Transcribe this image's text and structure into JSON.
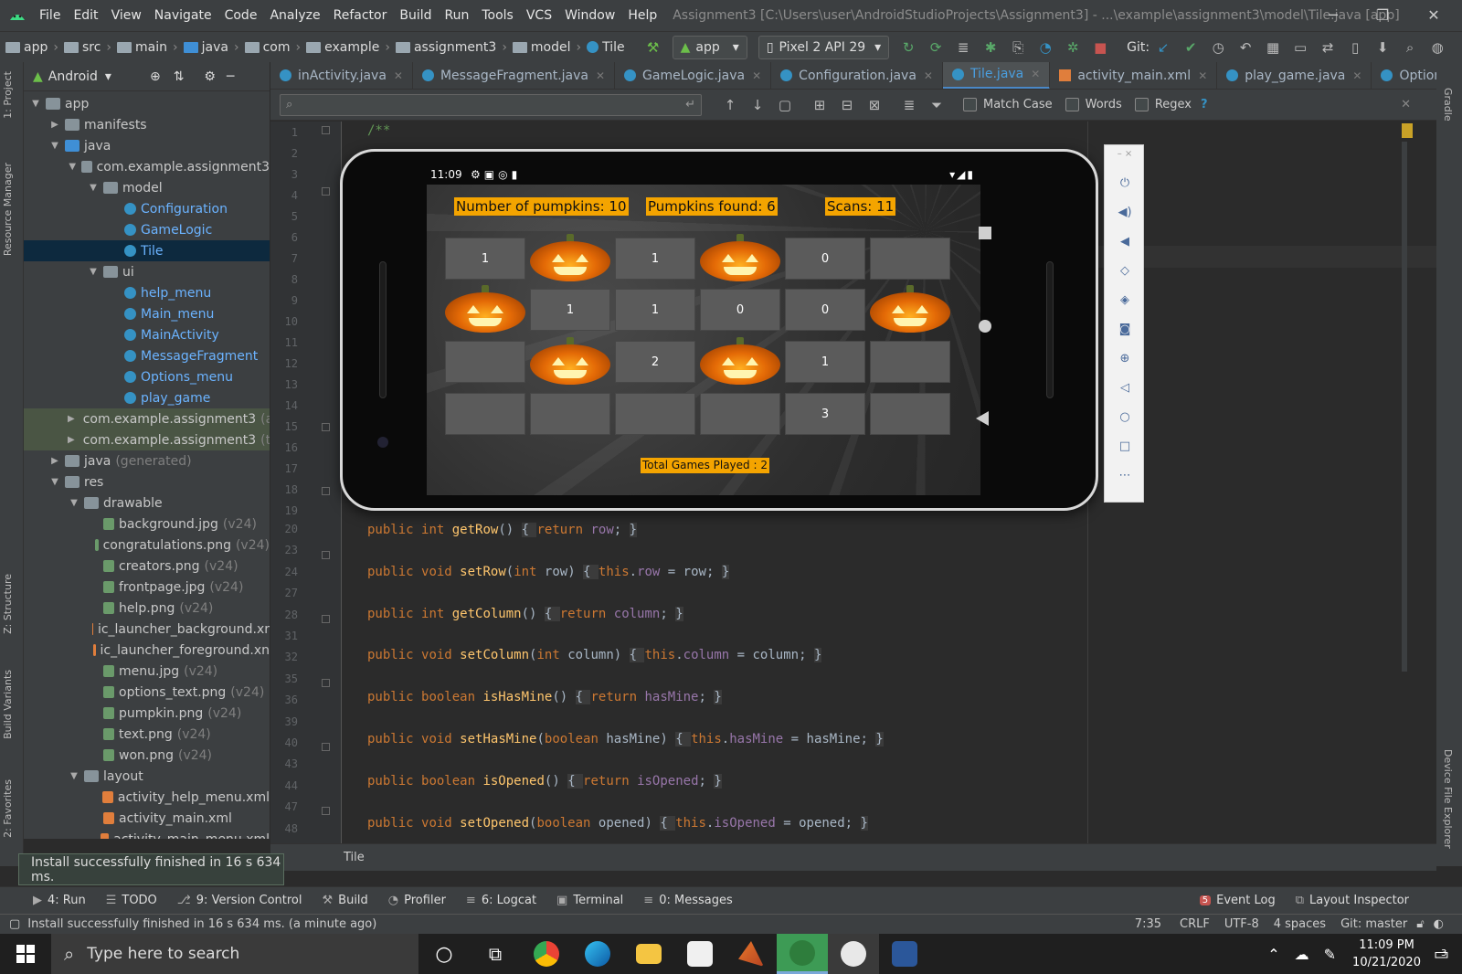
{
  "titlebar": {
    "menus": [
      "File",
      "Edit",
      "View",
      "Navigate",
      "Code",
      "Analyze",
      "Refactor",
      "Build",
      "Run",
      "Tools",
      "VCS",
      "Window",
      "Help"
    ],
    "title": "Assignment3 [C:\\Users\\user\\AndroidStudioProjects\\Assignment3] - ...\\example\\assignment3\\model\\Tile.java [app]"
  },
  "navbar": {
    "crumbs": [
      "app",
      "src",
      "main",
      "java",
      "com",
      "example",
      "assignment3",
      "model",
      "Tile"
    ],
    "run_config": "app",
    "device": "Pixel 2 API 29",
    "git_label": "Git:"
  },
  "project_panel": {
    "view_mode": "Android",
    "tree": [
      {
        "label": "app",
        "depth": 0,
        "arrow": "▼",
        "icon": "folder"
      },
      {
        "label": "manifests",
        "depth": 1,
        "arrow": "▶",
        "icon": "folder"
      },
      {
        "label": "java",
        "depth": 1,
        "arrow": "▼",
        "icon": "jfolder"
      },
      {
        "label": "com.example.assignment3",
        "depth": 2,
        "arrow": "▼",
        "icon": "folder"
      },
      {
        "label": "model",
        "depth": 3,
        "arrow": "▼",
        "icon": "folder"
      },
      {
        "label": "Configuration",
        "depth": 4,
        "icon": "cls"
      },
      {
        "label": "GameLogic",
        "depth": 4,
        "icon": "cls"
      },
      {
        "label": "Tile",
        "depth": 4,
        "icon": "cls",
        "selected": true
      },
      {
        "label": "ui",
        "depth": 3,
        "arrow": "▼",
        "icon": "folder"
      },
      {
        "label": "help_menu",
        "depth": 4,
        "icon": "cls"
      },
      {
        "label": "Main_menu",
        "depth": 4,
        "icon": "cls"
      },
      {
        "label": "MainActivity",
        "depth": 4,
        "icon": "cls"
      },
      {
        "label": "MessageFragment",
        "depth": 4,
        "icon": "cls"
      },
      {
        "label": "Options_menu",
        "depth": 4,
        "icon": "cls"
      },
      {
        "label": "play_game",
        "depth": 4,
        "icon": "cls"
      },
      {
        "label": "com.example.assignment3",
        "suffix": "(ar",
        "depth": 2,
        "arrow": "▶",
        "icon": "folder",
        "group": true
      },
      {
        "label": "com.example.assignment3",
        "suffix": "(te",
        "depth": 2,
        "arrow": "▶",
        "icon": "folder",
        "group": true
      },
      {
        "label": "java",
        "suffix": "(generated)",
        "depth": 1,
        "arrow": "▶",
        "icon": "folder"
      },
      {
        "label": "res",
        "depth": 1,
        "arrow": "▼",
        "icon": "folder"
      },
      {
        "label": "drawable",
        "depth": 2,
        "arrow": "▼",
        "icon": "folder"
      },
      {
        "label": "background.jpg",
        "suffix": "(v24)",
        "depth": 3,
        "icon": "img"
      },
      {
        "label": "congratulations.png",
        "suffix": "(v24)",
        "depth": 3,
        "icon": "img"
      },
      {
        "label": "creators.png",
        "suffix": "(v24)",
        "depth": 3,
        "icon": "img"
      },
      {
        "label": "frontpage.jpg",
        "suffix": "(v24)",
        "depth": 3,
        "icon": "img"
      },
      {
        "label": "help.png",
        "suffix": "(v24)",
        "depth": 3,
        "icon": "img"
      },
      {
        "label": "ic_launcher_background.xr",
        "depth": 3,
        "icon": "xml"
      },
      {
        "label": "ic_launcher_foreground.xn",
        "depth": 3,
        "icon": "xml"
      },
      {
        "label": "menu.jpg",
        "suffix": "(v24)",
        "depth": 3,
        "icon": "img"
      },
      {
        "label": "options_text.png",
        "suffix": "(v24)",
        "depth": 3,
        "icon": "img"
      },
      {
        "label": "pumpkin.png",
        "suffix": "(v24)",
        "depth": 3,
        "icon": "img"
      },
      {
        "label": "text.png",
        "suffix": "(v24)",
        "depth": 3,
        "icon": "img"
      },
      {
        "label": "won.png",
        "suffix": "(v24)",
        "depth": 3,
        "icon": "img"
      },
      {
        "label": "layout",
        "depth": 2,
        "arrow": "▼",
        "icon": "folder"
      },
      {
        "label": "activity_help_menu.xml",
        "depth": 3,
        "icon": "xml"
      },
      {
        "label": "activity_main.xml",
        "depth": 3,
        "icon": "xml"
      },
      {
        "label": "activity_main_menu.xml",
        "depth": 3,
        "icon": "xml"
      }
    ]
  },
  "left_toolwindows": [
    "1: Project",
    "Resource Manager",
    "Z: Structure",
    "Build Variants",
    "2: Favorites"
  ],
  "right_toolwindows": [
    "Gradle",
    "Device File Explorer"
  ],
  "editor_tabs": [
    {
      "label": "inActivity.java",
      "kind": "class"
    },
    {
      "label": "MessageFragment.java",
      "kind": "class"
    },
    {
      "label": "GameLogic.java",
      "kind": "class"
    },
    {
      "label": "Configuration.java",
      "kind": "class"
    },
    {
      "label": "Tile.java",
      "kind": "class",
      "active": true
    },
    {
      "label": "activity_main.xml",
      "kind": "xml"
    },
    {
      "label": "play_game.java",
      "kind": "class"
    },
    {
      "label": "Options_menu.java",
      "kind": "class"
    }
  ],
  "search": {
    "placeholder": "",
    "match_case": "Match Case",
    "words": "Words",
    "regex": "Regex",
    "help": "?"
  },
  "line_numbers": [
    "1",
    "2",
    "3",
    "4",
    "5",
    "6",
    "7",
    "8",
    "9",
    "10",
    "11",
    "12",
    "13",
    "14",
    "15",
    "16",
    "17",
    "18",
    "19",
    "20",
    "23",
    "24",
    "27",
    "28",
    "31",
    "32",
    "35",
    "36",
    "39",
    "40",
    "43",
    "44",
    "47",
    "48"
  ],
  "code_lines": [
    {
      "ln": "20",
      "parts": [
        [
          "kw",
          "public "
        ],
        [
          "kw",
          "int "
        ],
        [
          "fn",
          "getRow"
        ],
        [
          "",
          "() "
        ],
        [
          "br",
          "{ "
        ],
        [
          "kw",
          "return "
        ],
        [
          "fld",
          "row"
        ],
        [
          "",
          "; "
        ],
        [
          "br",
          "}"
        ]
      ]
    },
    {
      "ln": "24",
      "parts": [
        [
          "kw",
          "public "
        ],
        [
          "kw",
          "void "
        ],
        [
          "fn",
          "setRow"
        ],
        [
          "",
          "("
        ],
        [
          "kw",
          "int "
        ],
        [
          "",
          "row) "
        ],
        [
          "br",
          "{ "
        ],
        [
          "kw",
          "this"
        ],
        [
          "",
          "."
        ],
        [
          "fld",
          "row"
        ],
        [
          "",
          " = row; "
        ],
        [
          "br",
          "}"
        ]
      ]
    },
    {
      "ln": "28",
      "parts": [
        [
          "kw",
          "public "
        ],
        [
          "kw",
          "int "
        ],
        [
          "fn",
          "getColumn"
        ],
        [
          "",
          "() "
        ],
        [
          "br",
          "{ "
        ],
        [
          "kw",
          "return "
        ],
        [
          "fld",
          "column"
        ],
        [
          "",
          "; "
        ],
        [
          "br",
          "}"
        ]
      ]
    },
    {
      "ln": "32",
      "parts": [
        [
          "kw",
          "public "
        ],
        [
          "kw",
          "void "
        ],
        [
          "fn",
          "setColumn"
        ],
        [
          "",
          "("
        ],
        [
          "kw",
          "int "
        ],
        [
          "",
          "column) "
        ],
        [
          "br",
          "{ "
        ],
        [
          "kw",
          "this"
        ],
        [
          "",
          "."
        ],
        [
          "fld",
          "column"
        ],
        [
          "",
          " = column; "
        ],
        [
          "br",
          "}"
        ]
      ]
    },
    {
      "ln": "36",
      "parts": [
        [
          "kw",
          "public "
        ],
        [
          "kw",
          "boolean "
        ],
        [
          "fn",
          "isHasMine"
        ],
        [
          "",
          "() "
        ],
        [
          "br",
          "{ "
        ],
        [
          "kw",
          "return "
        ],
        [
          "fld",
          "hasMine"
        ],
        [
          "",
          "; "
        ],
        [
          "br",
          "}"
        ]
      ]
    },
    {
      "ln": "40",
      "parts": [
        [
          "kw",
          "public "
        ],
        [
          "kw",
          "void "
        ],
        [
          "fn",
          "setHasMine"
        ],
        [
          "",
          "("
        ],
        [
          "kw",
          "boolean "
        ],
        [
          "",
          "hasMine) "
        ],
        [
          "br",
          "{ "
        ],
        [
          "kw",
          "this"
        ],
        [
          "",
          "."
        ],
        [
          "fld",
          "hasMine"
        ],
        [
          "",
          " = hasMine; "
        ],
        [
          "br",
          "}"
        ]
      ]
    },
    {
      "ln": "44",
      "parts": [
        [
          "kw",
          "public "
        ],
        [
          "kw",
          "boolean "
        ],
        [
          "fn",
          "isOpened"
        ],
        [
          "",
          "() "
        ],
        [
          "br",
          "{ "
        ],
        [
          "kw",
          "return "
        ],
        [
          "fld",
          "isOpened"
        ],
        [
          "",
          "; "
        ],
        [
          "br",
          "}"
        ]
      ]
    },
    {
      "ln": "48",
      "parts": [
        [
          "kw",
          "public "
        ],
        [
          "kw",
          "void "
        ],
        [
          "fn",
          "setOpened"
        ],
        [
          "",
          "("
        ],
        [
          "kw",
          "boolean "
        ],
        [
          "",
          "opened) "
        ],
        [
          "br",
          "{ "
        ],
        [
          "kw",
          "this"
        ],
        [
          "",
          "."
        ],
        [
          "fld",
          "isOpened"
        ],
        [
          "",
          " = opened; "
        ],
        [
          "br",
          "}"
        ]
      ]
    }
  ],
  "code_head": "/**",
  "breadcrumb_bottom": "Tile",
  "notification": "Install successfully finished in 16 s 634 ms.",
  "bottom_tools": [
    {
      "icon": "▶",
      "label": "4: Run"
    },
    {
      "icon": "☰",
      "label": "TODO"
    },
    {
      "icon": "⎇",
      "label": "9: Version Control"
    },
    {
      "icon": "⚒",
      "label": "Build"
    },
    {
      "icon": "◔",
      "label": "Profiler"
    },
    {
      "icon": "≡",
      "label": "6: Logcat"
    },
    {
      "icon": "▣",
      "label": "Terminal"
    },
    {
      "icon": "≡",
      "label": "0: Messages"
    }
  ],
  "bottom_right_tools": [
    {
      "label": "Event Log",
      "badge": "5"
    },
    {
      "label": "Layout Inspector"
    }
  ],
  "statusbar": {
    "message": "Install successfully finished in 16 s 634 ms. (a minute ago)",
    "position": "7:35",
    "line_sep": "CRLF",
    "encoding": "UTF-8",
    "indent": "4 spaces",
    "git": "Git: master"
  },
  "phone": {
    "time": "11:09",
    "labels": {
      "pumpkins": "Number of pumpkins: 10",
      "found": "Pumpkins found: 6",
      "scans": "Scans: 11",
      "games": "Total Games Played : 2"
    },
    "grid": [
      [
        "1",
        "P",
        "1",
        "P",
        "0",
        ""
      ],
      [
        "P",
        "1",
        "1",
        "0",
        "0",
        "P"
      ],
      [
        "",
        "P",
        "2",
        "P",
        "1",
        ""
      ],
      [
        "",
        "",
        "",
        "",
        "3",
        ""
      ]
    ]
  },
  "taskbar": {
    "search_placeholder": "Type here to search",
    "time": "11:09 PM",
    "date": "10/21/2020",
    "notification_count": "3"
  },
  "colors": {
    "accent": "#4a88c7",
    "label_bg": "#f4a400",
    "pumpkin": "#e46a06"
  }
}
